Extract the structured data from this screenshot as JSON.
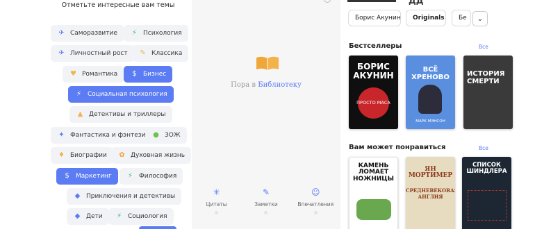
{
  "topics": {
    "title": "Отметьте интересные вам темы",
    "chips": [
      {
        "label": "Саморазвитие",
        "selected": false,
        "icon": "bird-icon",
        "glyph": "✈",
        "color": "#5b7cf3"
      },
      {
        "label": "Психология",
        "selected": false,
        "icon": "bolt-icon",
        "glyph": "⚡",
        "color": "#3fbf6f"
      },
      {
        "label": "Личностный рост",
        "selected": false,
        "icon": "bird-icon",
        "glyph": "✈",
        "color": "#5b7cf3"
      },
      {
        "label": "Классика",
        "selected": false,
        "icon": "feather-icon",
        "glyph": "✎",
        "color": "#e6b84a"
      },
      {
        "label": "Романтика",
        "selected": false,
        "icon": "heart-icon",
        "glyph": "♥",
        "color": "#f1b54a"
      },
      {
        "label": "Бизнес",
        "selected": true,
        "icon": "dollar-icon",
        "glyph": "$",
        "color": "#ffffff"
      },
      {
        "label": "Социальная психология",
        "selected": true,
        "icon": "bolt-icon",
        "glyph": "⚡",
        "color": "#ffffff"
      },
      {
        "label": "Детективы и триллеры",
        "selected": false,
        "icon": "hat-icon",
        "glyph": "▲",
        "color": "#f1b54a"
      },
      {
        "label": "Фантастика и фэнтези",
        "selected": false,
        "icon": "wand-icon",
        "glyph": "✦",
        "color": "#5b7cf3"
      },
      {
        "label": "ЗОЖ",
        "selected": false,
        "icon": "apple-icon",
        "glyph": "●",
        "color": "#6cc24a"
      },
      {
        "label": "Биографии",
        "selected": false,
        "icon": "bulb-icon",
        "glyph": "♦",
        "color": "#f1b54a"
      },
      {
        "label": "Духовная жизнь",
        "selected": false,
        "icon": "lotus-icon",
        "glyph": "✿",
        "color": "#f1a33a"
      },
      {
        "label": "Маркетинг",
        "selected": true,
        "icon": "dollar-icon",
        "glyph": "$",
        "color": "#ffffff"
      },
      {
        "label": "Философия",
        "selected": false,
        "icon": "bolt-icon",
        "glyph": "⚡",
        "color": "#3fbf6f"
      },
      {
        "label": "Приключения и детективы",
        "selected": false,
        "icon": "duck-icon",
        "glyph": "◆",
        "color": "#5b7cf3"
      },
      {
        "label": "Дети",
        "selected": false,
        "icon": "duck-icon",
        "glyph": "◆",
        "color": "#5b7cf3"
      },
      {
        "label": "Социология",
        "selected": false,
        "icon": "bolt-icon",
        "glyph": "⚡",
        "color": "#3fbf6f"
      }
    ]
  },
  "library": {
    "empty_prefix": "Пора в ",
    "empty_link": "Библиотеку",
    "tabs": [
      {
        "label": "Цитаты",
        "icon": "quote-star-icon",
        "glyph": "✳"
      },
      {
        "label": "Заметки",
        "icon": "notes-icon",
        "glyph": "✎"
      },
      {
        "label": "Впечатления",
        "icon": "smile-icon",
        "glyph": "☺"
      }
    ]
  },
  "store": {
    "header_fragment": "ДД",
    "pills": [
      "Борис Акунин",
      "Originals",
      "Бе"
    ],
    "dropdown_glyph": "⌄",
    "bestsellers": {
      "title": "Бестселлеры",
      "all": "Все",
      "books": [
        {
          "title": "БОРИС АКУНИН",
          "subtitle": "ПРОСТО МАСА",
          "bg": "#0f0f0f",
          "fg": "#ffffff",
          "accent": "#c8262a"
        },
        {
          "title": "ВСЁ ХРЕНОВО",
          "subtitle": "МАРК МЭНСОН",
          "bg": "#5a8fe0",
          "fg": "#ffffff",
          "accent": "#2c2c3a"
        },
        {
          "title": "ИСТОРИЯ СМЕРТИ",
          "subtitle": "",
          "bg": "#3a3a3a",
          "fg": "#ffffff",
          "accent": "#8a8a8a"
        }
      ]
    },
    "recommended": {
      "title": "Вам может понравиться",
      "all": "Все",
      "books": [
        {
          "title": "КАМЕНЬ ЛОМАЕТ НОЖНИЦЫ",
          "subtitle": "",
          "bg": "#ffffff",
          "fg": "#111111",
          "accent": "#6aa84f"
        },
        {
          "title": "ЯН МОРТИМЕР",
          "subtitle": "СРЕДНЕВЕКОВАЯ АНГЛИЯ",
          "bg": "#e8dcc0",
          "fg": "#8a3a1a",
          "accent": "#c0392b"
        },
        {
          "title": "СПИСОК ШИНДЛЕРА",
          "subtitle": "",
          "bg": "#1c2733",
          "fg": "#ffffff",
          "accent": "#c0392b"
        }
      ]
    }
  }
}
